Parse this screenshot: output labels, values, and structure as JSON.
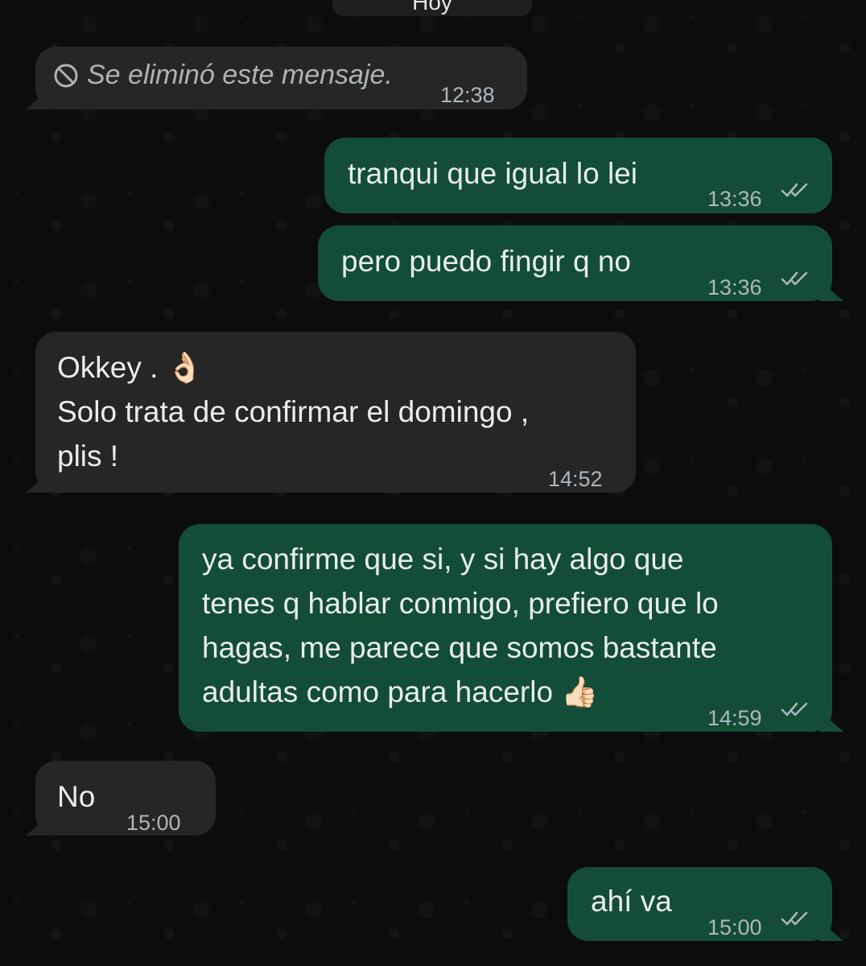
{
  "date_label": "Hoy",
  "messages": [
    {
      "text": "Se eliminó este mensaje.",
      "time": "12:38"
    },
    {
      "text": "tranqui que igual lo lei",
      "time": "13:36"
    },
    {
      "text": "pero puedo fingir q no",
      "time": "13:36"
    },
    {
      "line1": "Okkey . 👌🏻",
      "line2": "Solo trata de confirmar el domingo ,",
      "line3": "plis !",
      "time": "14:52"
    },
    {
      "line1": "ya confirme que si, y si hay algo que",
      "line2": "tenes q hablar conmigo, prefiero que lo",
      "line3": "hagas, me parece que somos bastante",
      "line4": "adultas como para hacerlo 👍🏻",
      "time": "14:59"
    },
    {
      "text": "No",
      "time": "15:00"
    },
    {
      "text": "ahí va",
      "time": "15:00"
    }
  ],
  "colors": {
    "incoming_bubble": "#262626",
    "outgoing_bubble": "#134d37",
    "read_check": "#aeb7bc"
  }
}
